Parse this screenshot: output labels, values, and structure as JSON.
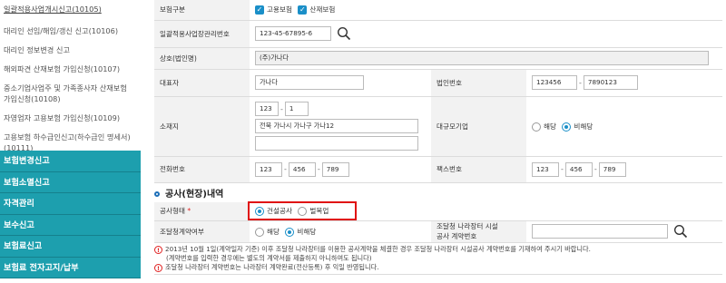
{
  "sidebar": {
    "links": [
      "일괄적용사업개시신고(10105)",
      "대리인 선임/해임/갱신 신고(10106)",
      "대리인 정보변경 신고",
      "해외파견 산재보험 가입신청(10107)",
      "중소기업사업주 및 가족종사자 산재보험가입신청(10108)",
      "자영업자 고용보험 가입신청(10109)",
      "고용보험 하수급인신고(하수급인 명세서)(10111)"
    ],
    "menus": [
      "보험변경신고",
      "보험소멸신고",
      "자격관리",
      "보수신고",
      "보험료신고",
      "보험료 전자고지/납부"
    ]
  },
  "form": {
    "insurance_type": {
      "label": "보험구분",
      "options": [
        "고용보험",
        "산재보험"
      ]
    },
    "mgmt_no": {
      "label": "일괄적용사업장관리번호",
      "value": "123-45-67895-6"
    },
    "company_name": {
      "label": "상호(법인명)",
      "value": "(주)가나다"
    },
    "representative": {
      "label": "대표자",
      "value": "가나다"
    },
    "corp_no": {
      "label": "법인번호",
      "part1": "123456",
      "part2": "7890123"
    },
    "address": {
      "label": "소재지",
      "zip1": "123",
      "zip2": "1",
      "line1": "전북 가나시 가나구 가나12",
      "line2": ""
    },
    "size": {
      "label": "대규모기업",
      "options": [
        "해당",
        "비해당"
      ],
      "selected": "비해당"
    },
    "phone": {
      "label": "전화번호",
      "p1": "123",
      "p2": "456",
      "p3": "789"
    },
    "fax": {
      "label": "팩스번호",
      "p1": "123",
      "p2": "456",
      "p3": "789"
    }
  },
  "section": {
    "title": "공사(현장)내역"
  },
  "construction": {
    "type": {
      "label": "공사형태",
      "options": [
        "건설공사",
        "벌목업"
      ],
      "selected": "건설공사"
    },
    "contract": {
      "label": "조달청계약여부",
      "options": [
        "해당",
        "비해당"
      ],
      "selected": "비해당"
    },
    "facility_no": {
      "label_line1": "조달청 나라장터 시설",
      "label_line2": "공사 계약번호",
      "value": ""
    }
  },
  "notices": {
    "n1_line1": "2013년 10월 1일(계약일자 기준) 이후 조달청 나라장터를 이용한 공사계약을 체결한 경우 조달청 나라장터 시설공사 계약번호를 기재하여 주시기 바랍니다.",
    "n1_line2": "(계약번호를 입력한 경우에는 별도의 계약서를 제출하지 아니하여도 됩니다)",
    "n2": "조달청 나라장터 계약번호는 나라장터 계약완료(전산등록) 후 익일 반영됩니다."
  }
}
